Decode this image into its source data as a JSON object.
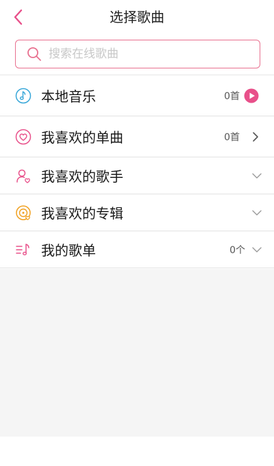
{
  "header": {
    "title": "选择歌曲"
  },
  "search": {
    "placeholder": "搜索在线歌曲"
  },
  "items": [
    {
      "label": "本地音乐",
      "count": "0首",
      "action": "play-icon"
    },
    {
      "label": "我喜欢的单曲",
      "count": "0首",
      "action": "chevron-right-icon"
    },
    {
      "label": "我喜欢的歌手",
      "count": "",
      "action": "chevron-down-icon"
    },
    {
      "label": "我喜欢的专辑",
      "count": "",
      "action": "chevron-down-icon"
    },
    {
      "label": "我的歌单",
      "count": "0个",
      "action": "chevron-down-icon"
    }
  ],
  "colors": {
    "accent": "#e8508a",
    "search_border": "#e8708f",
    "local_music_icon": "#36a6d8",
    "liked_song_icon": "#e8508a",
    "liked_artist_icon": "#e8508a",
    "liked_album_icon": "#f0a020",
    "playlist_icon": "#e8508a"
  }
}
